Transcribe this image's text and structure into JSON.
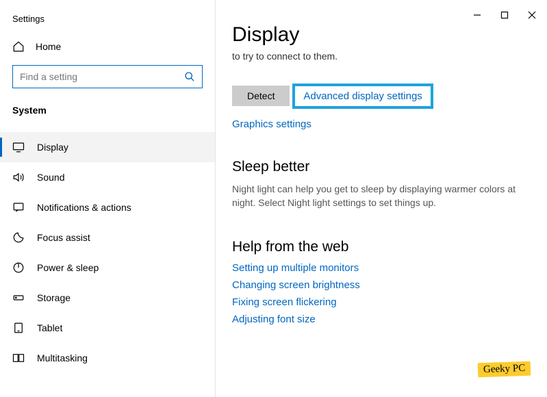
{
  "window": {
    "title": "Settings"
  },
  "sidebar": {
    "home": "Home",
    "search_placeholder": "Find a setting",
    "section": "System",
    "items": [
      {
        "label": "Display"
      },
      {
        "label": "Sound"
      },
      {
        "label": "Notifications & actions"
      },
      {
        "label": "Focus assist"
      },
      {
        "label": "Power & sleep"
      },
      {
        "label": "Storage"
      },
      {
        "label": "Tablet"
      },
      {
        "label": "Multitasking"
      }
    ]
  },
  "main": {
    "heading": "Display",
    "connect_text": "to try to connect to them.",
    "detect_btn": "Detect",
    "advanced_link": "Advanced display settings",
    "graphics_link": "Graphics settings",
    "sleep": {
      "heading": "Sleep better",
      "body": "Night light can help you get to sleep by displaying warmer colors at night. Select Night light settings to set things up."
    },
    "help": {
      "heading": "Help from the web",
      "links": [
        "Setting up multiple monitors",
        "Changing screen brightness",
        "Fixing screen flickering",
        "Adjusting font size"
      ]
    }
  },
  "watermark": "Geeky PC"
}
